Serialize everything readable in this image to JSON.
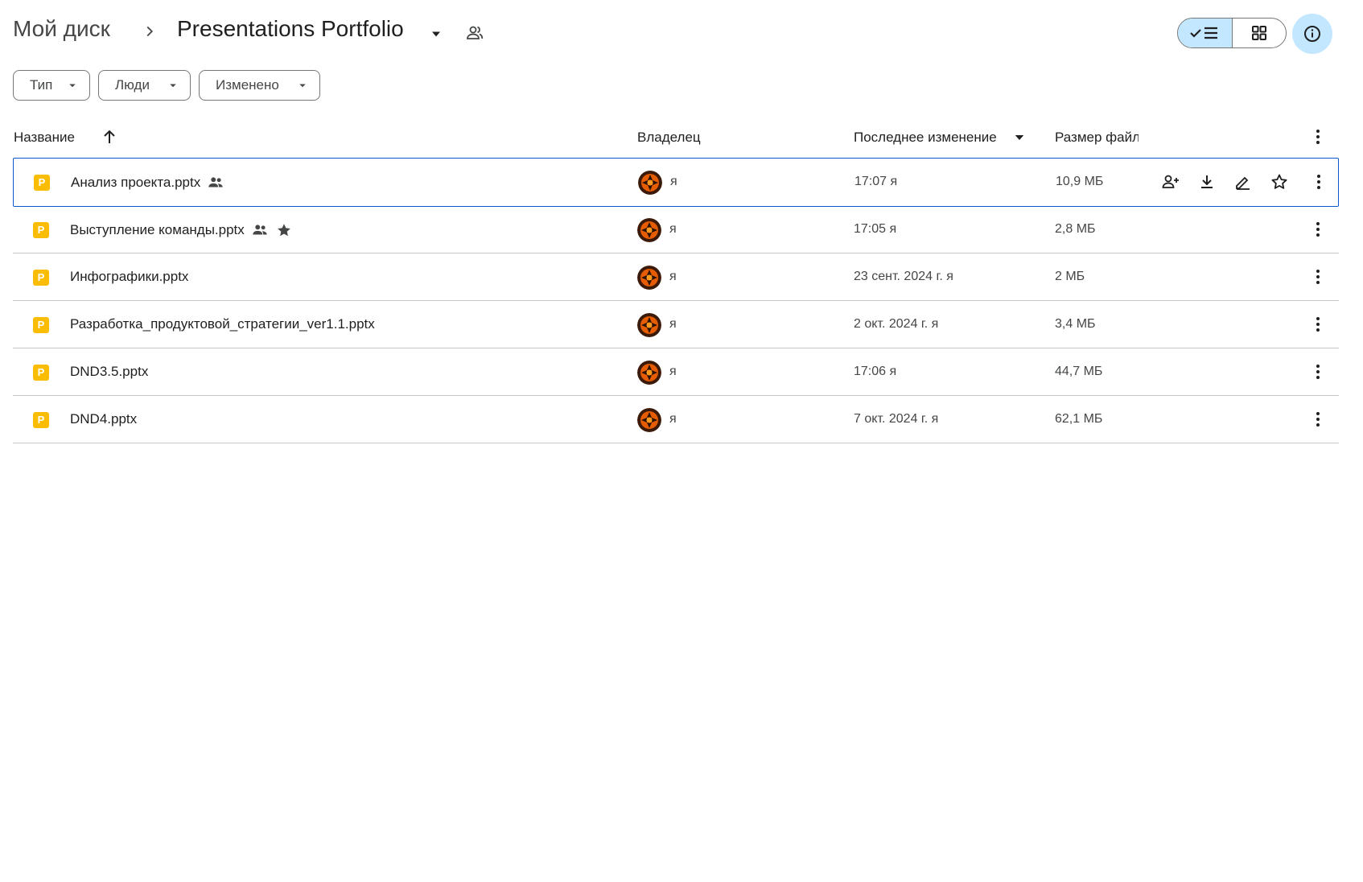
{
  "breadcrumb": {
    "root": "Мой диск",
    "current": "Presentations Portfolio"
  },
  "icons": {
    "separator": "chevron-right-icon",
    "folder_menu": "caret-down-icon",
    "shared": "shared-folder-icon",
    "list_view": "checked-list-view-icon",
    "grid_view": "grid-view-icon",
    "info": "info-icon"
  },
  "filters": [
    "Тип",
    "Люди",
    "Изменено"
  ],
  "columns": {
    "name": "Название",
    "owner": "Владелец",
    "modified": "Последнее изменение",
    "size": "Размер файла"
  },
  "files": [
    {
      "name": "Анализ проекта.pptx",
      "shared": true,
      "starred": false,
      "owner": "я",
      "modified": "17:07  я",
      "size": "10,9 МБ"
    },
    {
      "name": "Выступление команды.pptx",
      "shared": true,
      "starred": true,
      "owner": "я",
      "modified": "17:05  я",
      "size": "2,8 МБ"
    },
    {
      "name": "Инфографики.pptx",
      "shared": false,
      "starred": false,
      "owner": "я",
      "modified": "23 сент. 2024 г.  я",
      "size": "2 МБ"
    },
    {
      "name": "Разработка_продуктовой_стратегии_ver1.1.pptx",
      "shared": false,
      "starred": false,
      "owner": "я",
      "modified": "2 окт. 2024 г.  я",
      "size": "3,4 МБ"
    },
    {
      "name": "DND3.5.pptx",
      "shared": false,
      "starred": false,
      "owner": "я",
      "modified": "17:06  я",
      "size": "44,7 МБ"
    },
    {
      "name": "DND4.pptx",
      "shared": false,
      "starred": false,
      "owner": "я",
      "modified": "7 окт. 2024 г.  я",
      "size": "62,1 МБ"
    }
  ],
  "file_icon_letter": "P",
  "colors": {
    "accent": "#0b57d0",
    "toggle_bg": "#c2e7ff",
    "slides_icon": "#fbbc04"
  }
}
